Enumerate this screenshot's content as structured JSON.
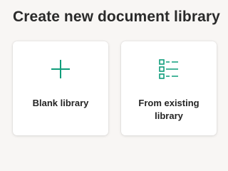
{
  "dialog": {
    "title": "Create new document library"
  },
  "options": [
    {
      "label": "Blank library",
      "icon": "plus-icon"
    },
    {
      "label": "From existing library",
      "icon": "list-icon"
    }
  ],
  "colors": {
    "accent": "#0f9d7b",
    "background": "#f8f6f4",
    "card": "#ffffff"
  }
}
